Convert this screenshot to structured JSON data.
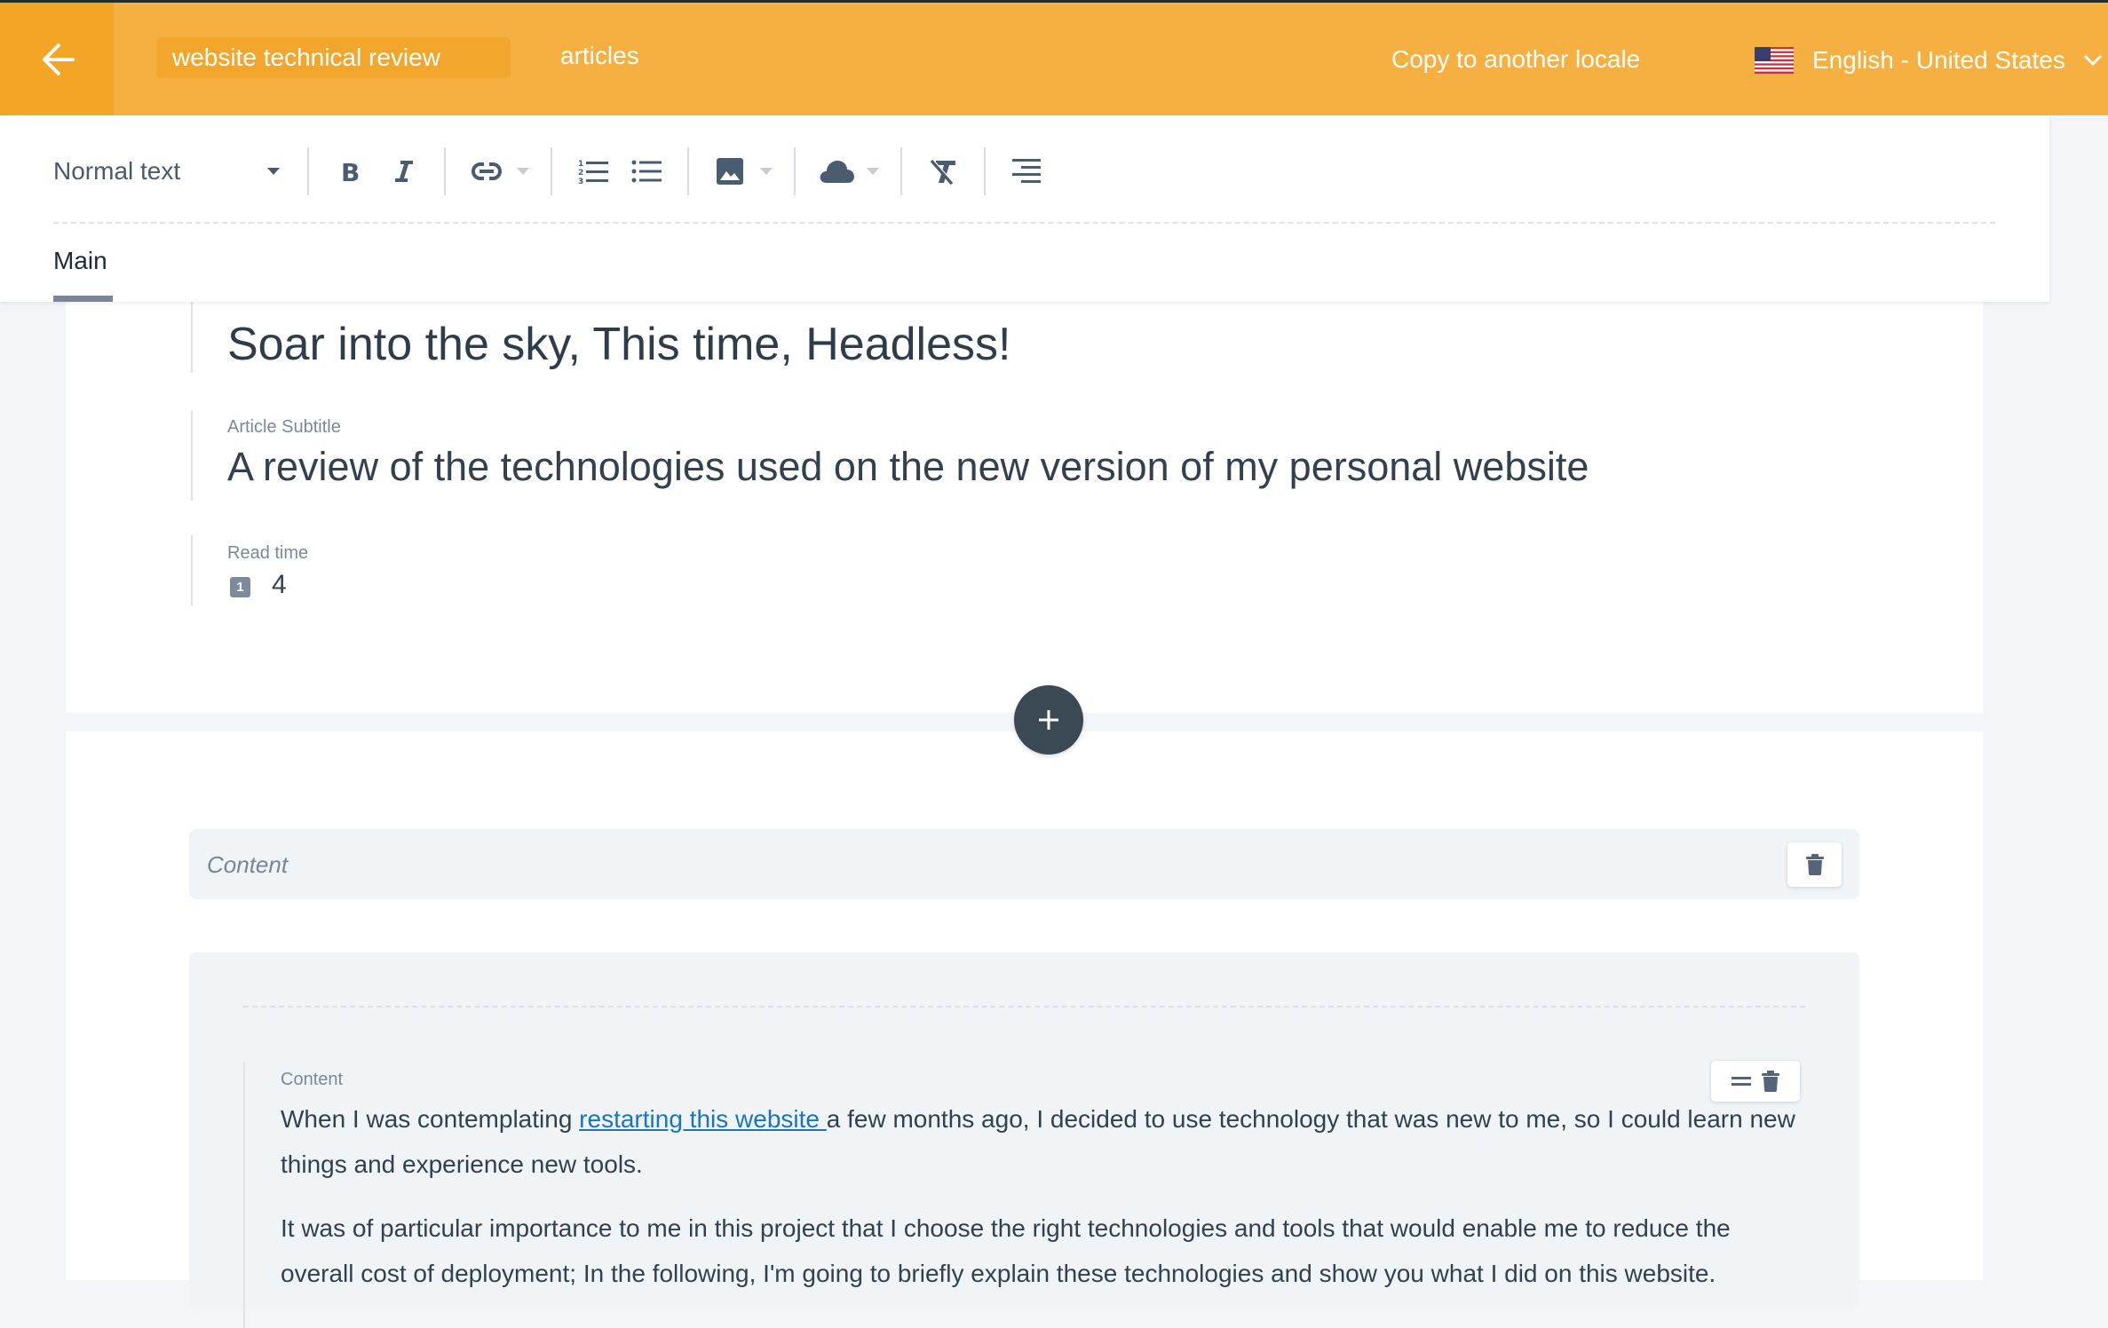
{
  "header": {
    "back_label": "Back",
    "title_value": "website technical review",
    "collection": "articles",
    "copy_locale": "Copy to another locale",
    "locale": "English - United States",
    "colors": {
      "header_bg": "#f5b041",
      "back_bg": "#f3a526"
    }
  },
  "toolbar": {
    "text_style": "Normal text",
    "buttons": [
      {
        "name": "bold",
        "icon": "bold-icon"
      },
      {
        "name": "italic",
        "icon": "italic-icon"
      },
      {
        "name": "link",
        "icon": "link-icon",
        "dropdown": true
      },
      {
        "name": "ordered-list",
        "icon": "ordered-list-icon"
      },
      {
        "name": "bullet-list",
        "icon": "bullet-list-icon"
      },
      {
        "name": "image",
        "icon": "image-icon",
        "dropdown": true
      },
      {
        "name": "embed",
        "icon": "cloud-icon",
        "dropdown": true
      },
      {
        "name": "clear-format",
        "icon": "clear-format-icon"
      },
      {
        "name": "align",
        "icon": "align-right-icon"
      }
    ]
  },
  "tabs": [
    {
      "label": "Main",
      "active": true
    }
  ],
  "article": {
    "title": "Soar into the sky, This time, Headless!",
    "subtitle_label": "Article Subtitle",
    "subtitle": "A review of the technologies used on the new version of my personal website",
    "read_time_label": "Read time",
    "read_time_badge": "1",
    "read_time": "4"
  },
  "content_section": {
    "label": "Content",
    "field_label": "Content",
    "paragraph1_before": "When I was contemplating ",
    "paragraph1_link": "restarting this website ",
    "paragraph1_after": "a few months ago, I decided to use technology that was new to me, so I could learn new things and experience new tools.",
    "paragraph2": "It was of particular importance to me in this project that I choose the right technologies and tools that would enable me to reduce the overall cost of deployment; In the following,  I'm going to briefly explain these technologies and show you what I did on this website."
  }
}
